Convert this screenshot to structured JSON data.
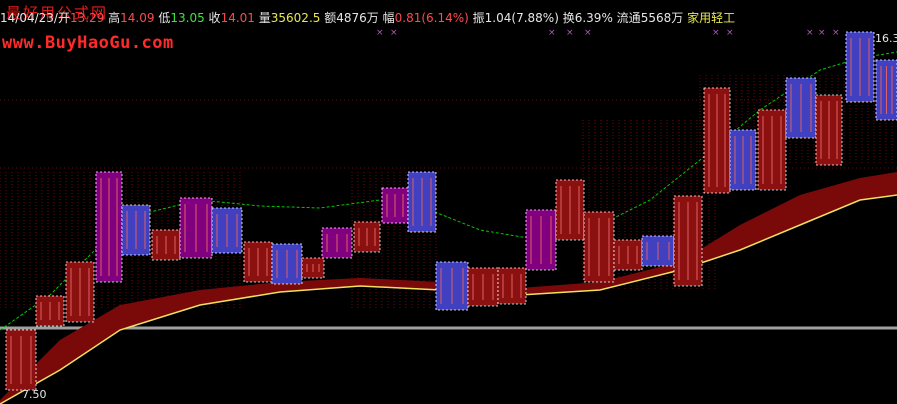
{
  "header": {
    "date": "14/04/23/",
    "open_label": "开",
    "open_value": "13.29",
    "high_label": "高",
    "high_value": "14.09",
    "low_label": "低",
    "low_value": "13.05",
    "close_label": "收",
    "close_value": "14.01",
    "volume_label": "量",
    "volume_value": "35602.5",
    "amount_label": "额",
    "amount_value": "4876万",
    "change_label": "幅",
    "change_value": "0.81(6.14%)",
    "amplitude_label": "振",
    "amplitude_value": "1.04(7.88%)",
    "turnover_label": "换",
    "turnover_value": "6.39%",
    "float_label": "流通",
    "float_value": "5568万",
    "sector_value": "家用轻工"
  },
  "overlay": {
    "watermark": "最好用公式网",
    "site_url": "www.BuyHaoGu.com"
  },
  "axis": {
    "high_price": "16.3",
    "low_price": "7.50"
  },
  "colors": {
    "background": "#000000",
    "up_candle": "#8b1010",
    "down_candle": "#4040c0",
    "purple_candle": "#800080",
    "dashed_box": "#ffffff",
    "ma_green": "#00c800",
    "band_dark_red": "#7a0a0a",
    "band_yellow": "#f0e060",
    "grid_red": "#b01010",
    "baseline_gray": "#a0a0a0"
  },
  "markers": [
    "×",
    "×",
    "×",
    "×",
    "×",
    "×",
    "×",
    "×",
    "×",
    "×"
  ]
}
